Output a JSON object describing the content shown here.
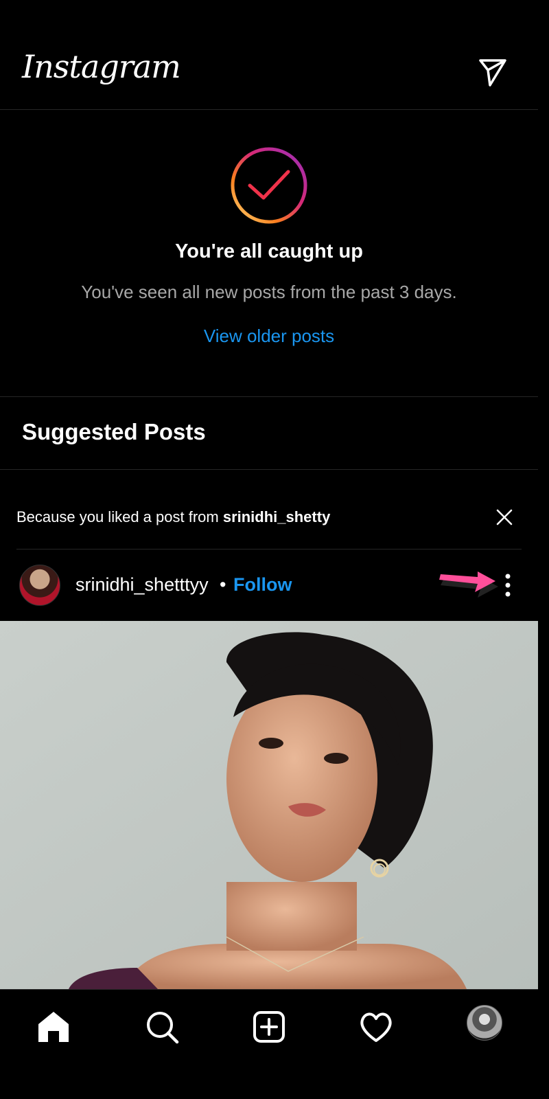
{
  "header": {
    "logo_text": "Instagram",
    "dm_icon": "paper-plane-icon"
  },
  "caught_up": {
    "icon": "check-circle-icon",
    "title": "You're all caught up",
    "subtitle": "You've seen all new posts from the past 3 days.",
    "link": "View older posts"
  },
  "suggested": {
    "heading": "Suggested Posts",
    "reason_prefix": "Because you liked a post from ",
    "reason_user": "srinidhi_shetty",
    "dismiss_icon": "close-icon"
  },
  "post": {
    "username": "srinidhi_shetttyy",
    "separator": "•",
    "follow_label": "Follow",
    "more_icon": "more-vertical-icon",
    "annotation_icon": "pink-arrow-icon"
  },
  "nav": {
    "items": [
      "home-icon",
      "search-icon",
      "new-post-icon",
      "activity-heart-icon",
      "profile-avatar"
    ]
  },
  "colors": {
    "accent": "#1a96f0",
    "background": "#000000",
    "secondary_text": "#a8a8a8",
    "arrow": "#ff4f9a"
  }
}
